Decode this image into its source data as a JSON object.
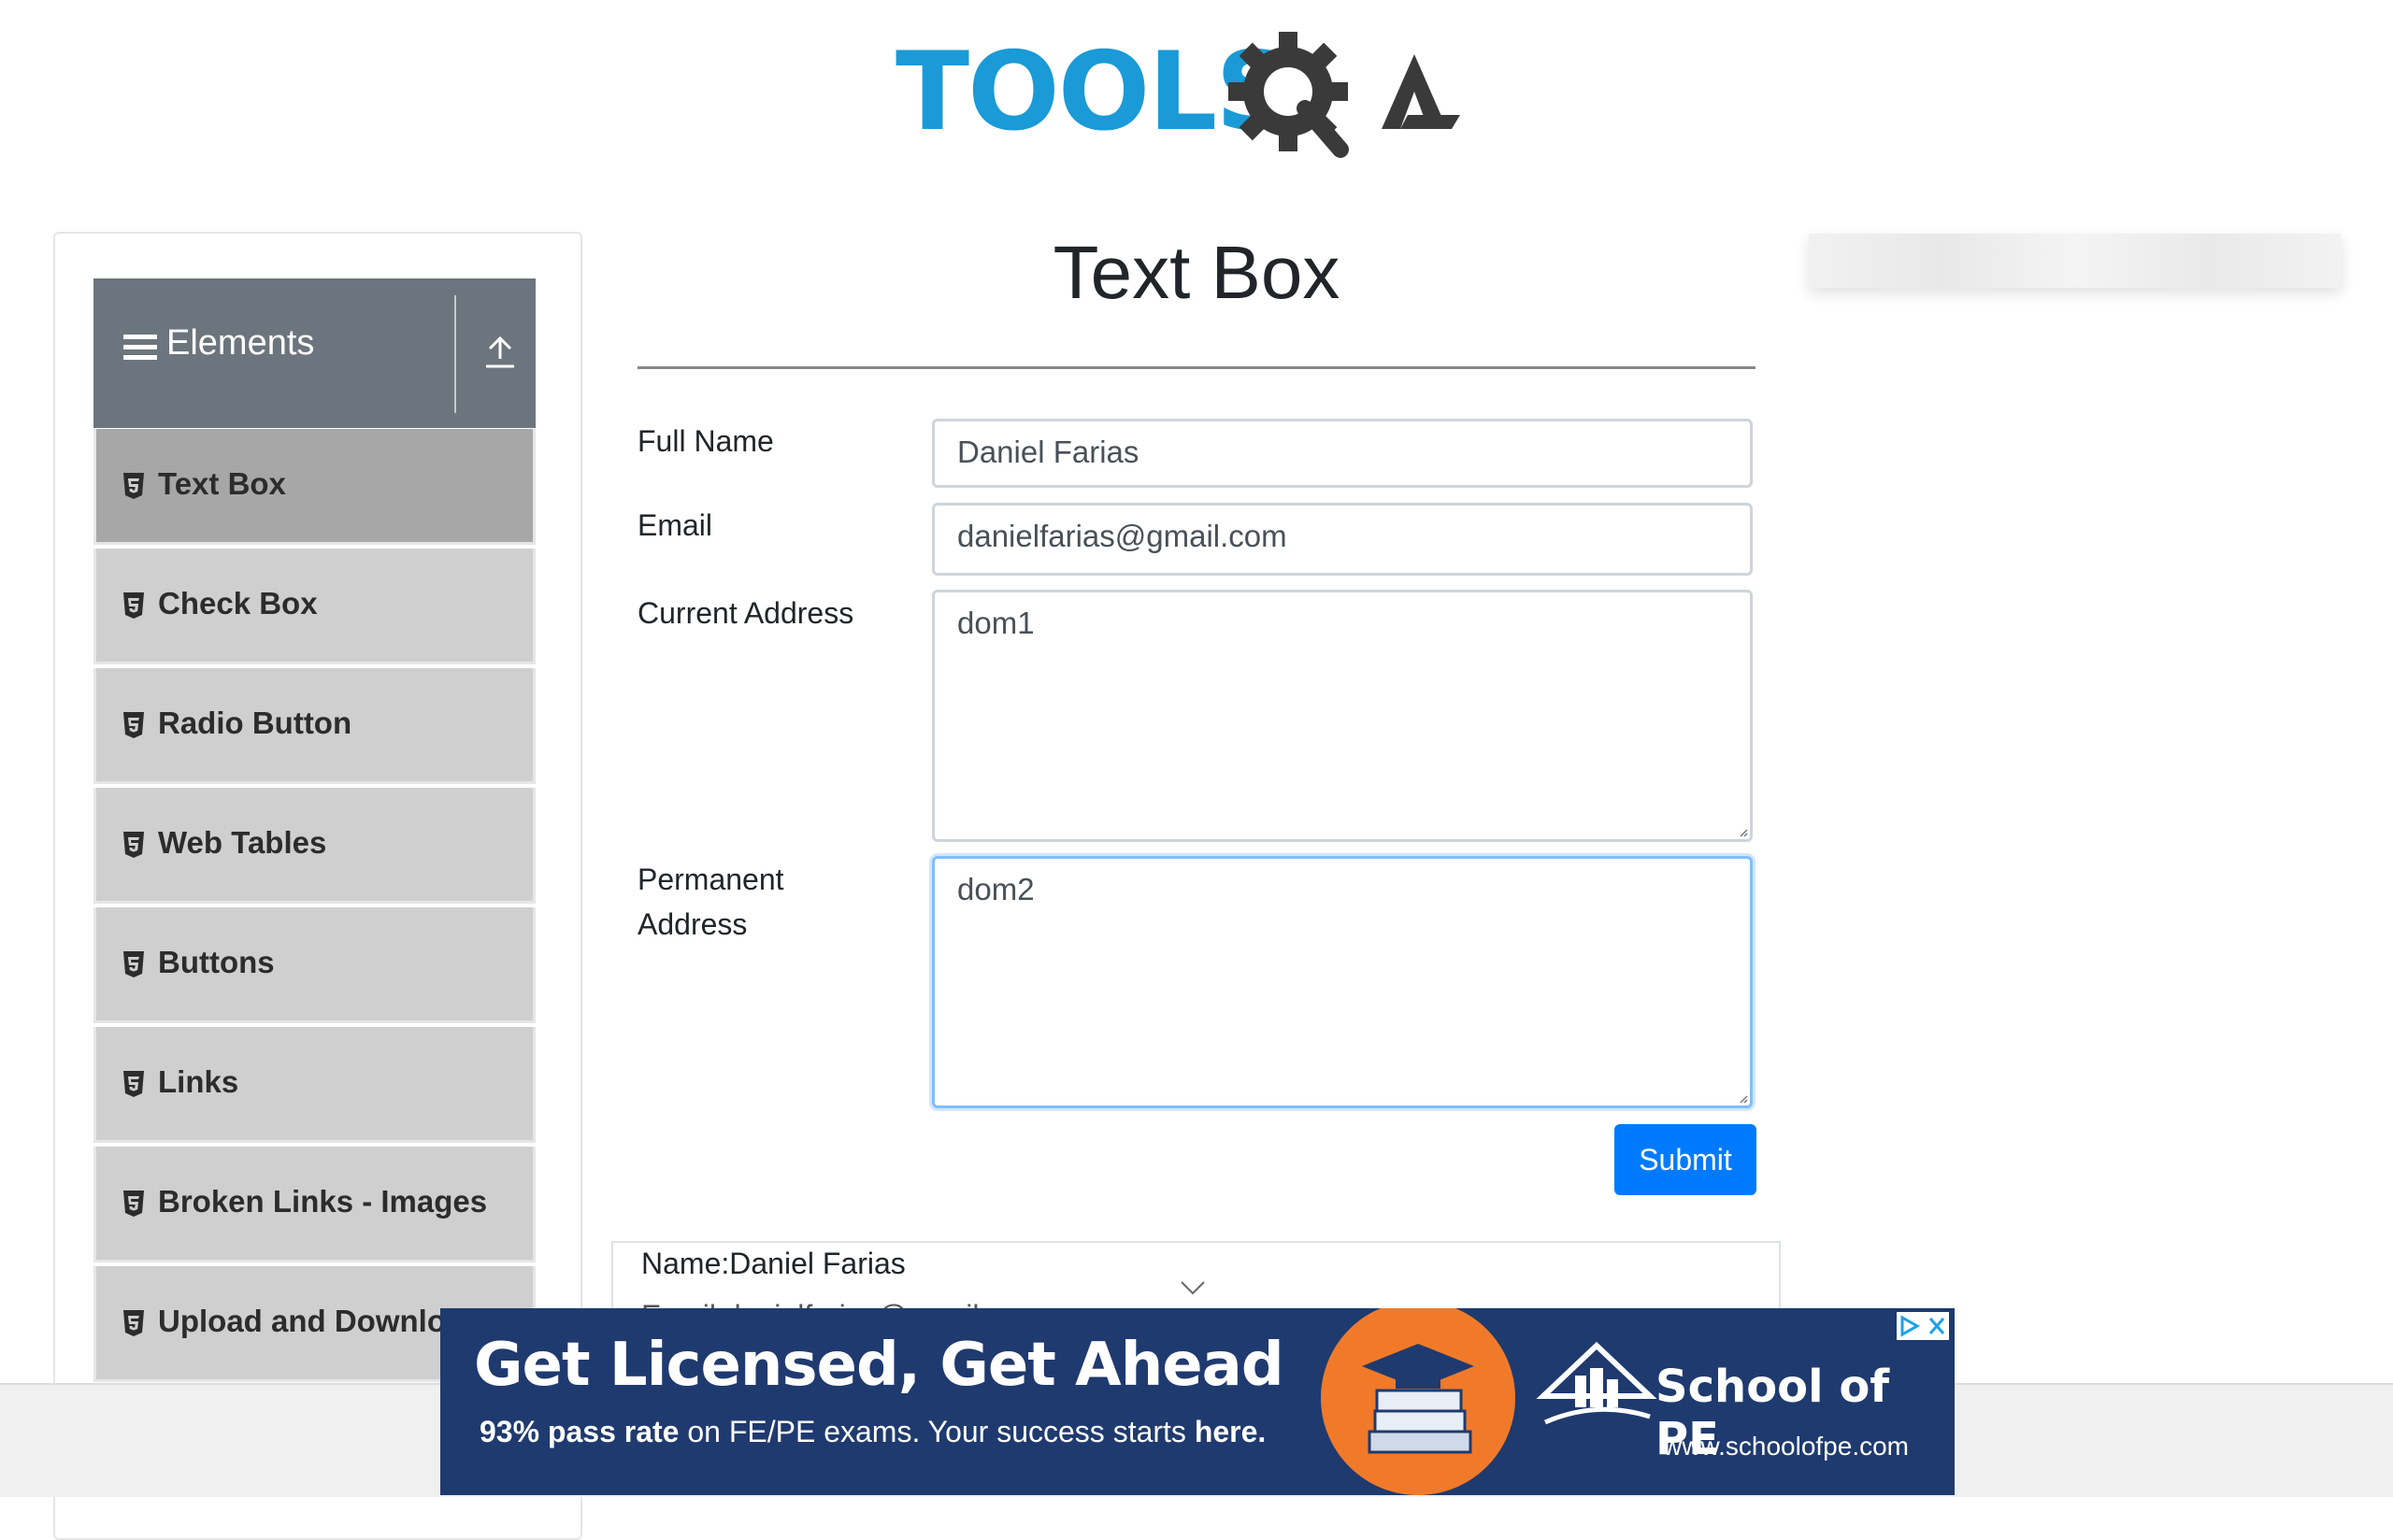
{
  "logo": {
    "text_left": "TOOLS",
    "text_right": "QA"
  },
  "sidebar": {
    "group_title": "Elements",
    "items": [
      {
        "label": "Text Box",
        "active": true
      },
      {
        "label": "Check Box"
      },
      {
        "label": "Radio Button"
      },
      {
        "label": "Web Tables"
      },
      {
        "label": "Buttons"
      },
      {
        "label": "Links"
      },
      {
        "label": "Broken Links - Images"
      },
      {
        "label": "Upload and Download"
      }
    ]
  },
  "main": {
    "title": "Text Box",
    "form": {
      "full_name_label": "Full Name",
      "full_name_value": "Daniel Farias",
      "email_label": "Email",
      "email_value": "danielfarias@gmail.com",
      "current_address_label": "Current Address",
      "current_address_value": "dom1",
      "permanent_address_label_1": "Permanent",
      "permanent_address_label_2": "Address",
      "permanent_address_value": "dom2",
      "submit_label": "Submit"
    },
    "output": {
      "name_line": "Name:Daniel Farias",
      "email_line": "Email:danielfarias@gmail.com"
    }
  },
  "ad": {
    "headline": "Get Licensed, Get Ahead",
    "sub_bold_1": "93% pass rate",
    "sub_text_1": " on FE/PE exams. Your success starts ",
    "sub_bold_2": "here.",
    "brand": "School of PE",
    "url": "www.schoolofpe.com"
  },
  "colors": {
    "accent": "#007bff",
    "logo_blue": "#1a9ad6",
    "logo_dark": "#3a3a3a",
    "ad_bg": "#1f3a6e",
    "ad_orange": "#f07a2a"
  }
}
